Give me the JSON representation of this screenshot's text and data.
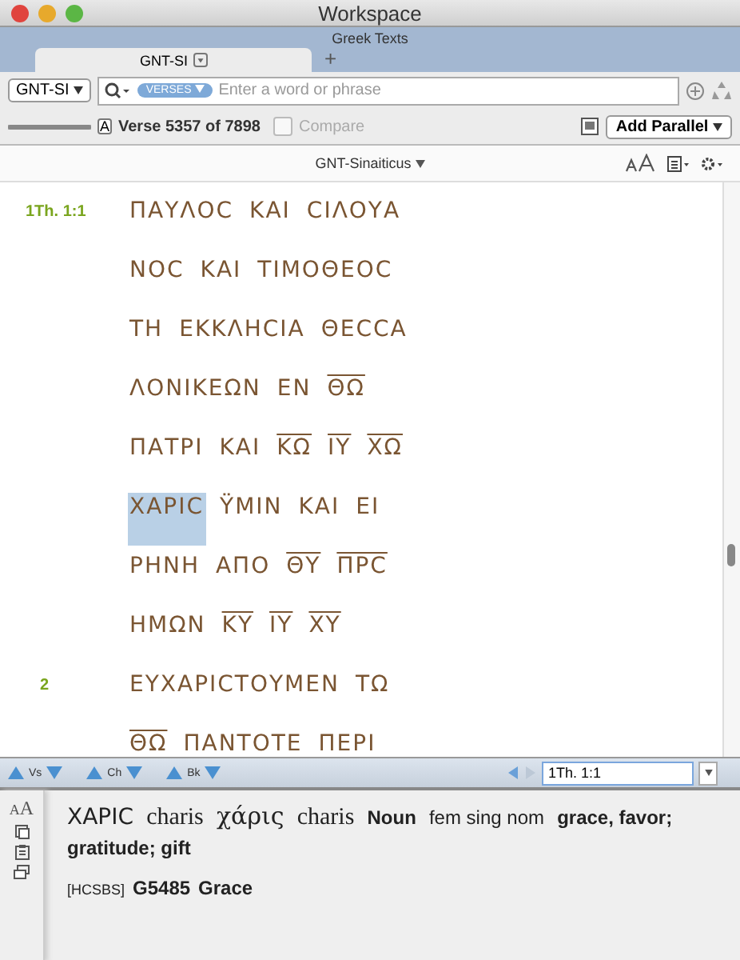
{
  "window": {
    "title": "Workspace"
  },
  "tab_group": {
    "title": "Greek Texts",
    "tabs": [
      {
        "label": "GNT-SI",
        "selected": true
      }
    ],
    "new_tab": "+"
  },
  "search": {
    "resource": "GNT-SI",
    "scope": "VERSES",
    "placeholder": "Enter a word or phrase"
  },
  "verse_bar": {
    "slider": {
      "level": 1.0
    },
    "font_button": "A",
    "position": "Verse 5357 of 7898",
    "compare": {
      "label": "Compare",
      "checked": false
    },
    "add_parallel": "Add Parallel"
  },
  "text_header": {
    "resource": "GNT-Sinaiticus"
  },
  "lines": [
    {
      "verse": "1Th. 1:1",
      "words": [
        {
          "text": "ΠΑΥΛΟϹ",
          "nomen_sacrum": false,
          "selected": false
        },
        {
          "text": "ΚΑΙ",
          "nomen_sacrum": false,
          "selected": false
        },
        {
          "text": "ϹΙΛΟΥΑ",
          "nomen_sacrum": false,
          "selected": false
        }
      ]
    },
    {
      "words": [
        {
          "text": "ΝΟϹ",
          "nomen_sacrum": false,
          "selected": false
        },
        {
          "text": "ΚΑΙ",
          "nomen_sacrum": false,
          "selected": false
        },
        {
          "text": "ΤΙΜΟΘΕΟϹ",
          "nomen_sacrum": false,
          "selected": false
        }
      ]
    },
    {
      "words": [
        {
          "text": "ΤΗ",
          "nomen_sacrum": false,
          "selected": false
        },
        {
          "text": "ΕΚΚΛΗϹΙΑ",
          "nomen_sacrum": false,
          "selected": false
        },
        {
          "text": "ΘΕϹϹΑ",
          "nomen_sacrum": false,
          "selected": false
        }
      ]
    },
    {
      "words": [
        {
          "text": "ΛΟΝΙΚΕΩΝ",
          "nomen_sacrum": false,
          "selected": false
        },
        {
          "text": "ΕΝ",
          "nomen_sacrum": false,
          "selected": false
        },
        {
          "text": "ΘΩ",
          "nomen_sacrum": true,
          "selected": false
        }
      ]
    },
    {
      "words": [
        {
          "text": "ΠΑΤΡΙ",
          "nomen_sacrum": false,
          "selected": false
        },
        {
          "text": "ΚΑΙ",
          "nomen_sacrum": false,
          "selected": false
        },
        {
          "text": "ΚΩ",
          "nomen_sacrum": true,
          "selected": false
        },
        {
          "text": "ΙΥ",
          "nomen_sacrum": true,
          "selected": false
        },
        {
          "text": "ΧΩ",
          "nomen_sacrum": true,
          "selected": false
        }
      ]
    },
    {
      "words": [
        {
          "text": "ΧΑΡΙϹ",
          "nomen_sacrum": false,
          "selected": true
        },
        {
          "text": "ΫΜΙΝ",
          "nomen_sacrum": false,
          "selected": false
        },
        {
          "text": "ΚΑΙ",
          "nomen_sacrum": false,
          "selected": false
        },
        {
          "text": "ΕΙ",
          "nomen_sacrum": false,
          "selected": false
        }
      ]
    },
    {
      "words": [
        {
          "text": "ΡΗΝΗ",
          "nomen_sacrum": false,
          "selected": false
        },
        {
          "text": "ΑΠΟ",
          "nomen_sacrum": false,
          "selected": false
        },
        {
          "text": "ΘΥ",
          "nomen_sacrum": true,
          "selected": false
        },
        {
          "text": "ΠΡϹ",
          "nomen_sacrum": true,
          "selected": false
        }
      ]
    },
    {
      "words": [
        {
          "text": "ΗΜΩΝ",
          "nomen_sacrum": false,
          "selected": false
        },
        {
          "text": "ΚΥ",
          "nomen_sacrum": true,
          "selected": false
        },
        {
          "text": "ΙΥ",
          "nomen_sacrum": true,
          "selected": false
        },
        {
          "text": "ΧΥ",
          "nomen_sacrum": true,
          "selected": false
        }
      ]
    },
    {
      "verse": "2",
      "words": [
        {
          "text": "ΕΥΧΑΡΙϹΤΟΥΜΕΝ",
          "nomen_sacrum": false,
          "selected": false
        },
        {
          "text": "ΤΩ",
          "nomen_sacrum": false,
          "selected": false
        }
      ]
    },
    {
      "words": [
        {
          "text": "ΘΩ",
          "nomen_sacrum": true,
          "selected": false
        },
        {
          "text": "ΠΑΝΤΟΤΕ",
          "nomen_sacrum": false,
          "selected": false
        },
        {
          "text": "ΠΕΡΙ",
          "nomen_sacrum": false,
          "selected": false
        }
      ]
    }
  ],
  "nav": {
    "steps": [
      "Vs",
      "Ch",
      "Bk"
    ],
    "reference": "1Th. 1:1"
  },
  "info": {
    "font_buttons": [
      "A",
      "A"
    ],
    "line_1": [
      {
        "kind": "form",
        "text": "ΧΑΡΙϹ"
      },
      {
        "kind": "translit",
        "text": "charis"
      },
      {
        "kind": "lemma",
        "text": "χάρις"
      },
      {
        "kind": "translit",
        "text": "charis"
      },
      {
        "kind": "pos",
        "text": "Noun"
      },
      {
        "kind": "parse",
        "text": "fem sing nom"
      },
      {
        "kind": "gloss",
        "text": "grace, favor; gratitude; gift"
      }
    ],
    "line_2": [
      {
        "kind": "tag",
        "text": "[HCSBS]"
      },
      {
        "kind": "strong",
        "text": "G5485"
      },
      {
        "kind": "gloss",
        "text": "Grace"
      }
    ]
  }
}
